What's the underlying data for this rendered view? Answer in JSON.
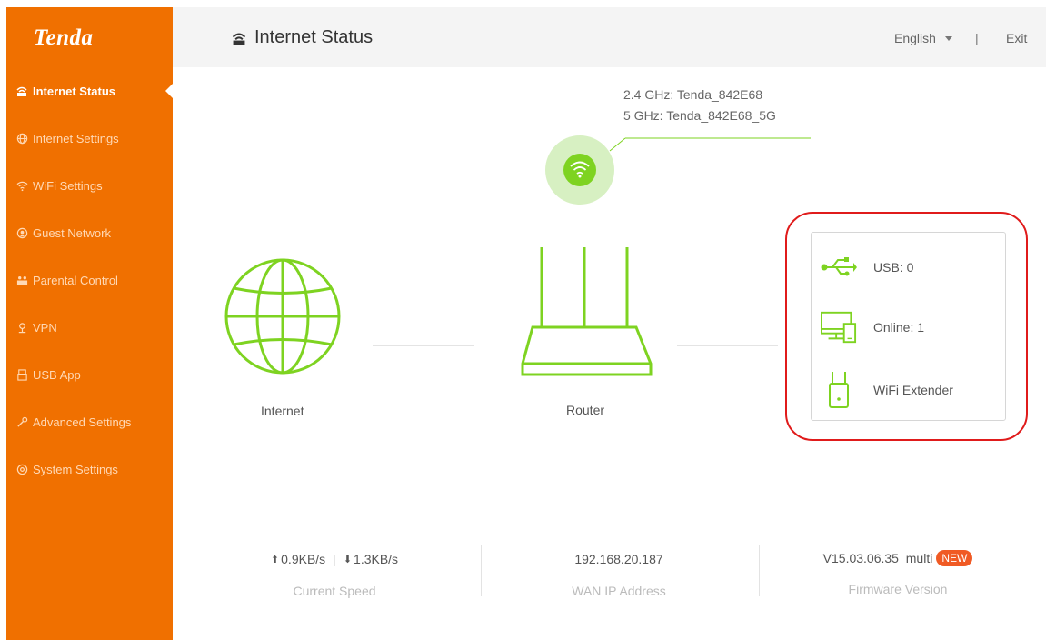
{
  "brand": {
    "logo": "Tenda"
  },
  "sidebar": {
    "items": [
      {
        "label": "Internet Status",
        "icon": "router-status-icon",
        "active": true
      },
      {
        "label": "Internet Settings",
        "icon": "globe-icon",
        "active": false
      },
      {
        "label": "WiFi Settings",
        "icon": "wifi-icon",
        "active": false
      },
      {
        "label": "Guest Network",
        "icon": "guest-icon",
        "active": false
      },
      {
        "label": "Parental Control",
        "icon": "family-icon",
        "active": false
      },
      {
        "label": "VPN",
        "icon": "vpn-icon",
        "active": false
      },
      {
        "label": "USB App",
        "icon": "usb-icon",
        "active": false
      },
      {
        "label": "Advanced Settings",
        "icon": "tools-icon",
        "active": false
      },
      {
        "label": "System Settings",
        "icon": "gear-icon",
        "active": false
      }
    ]
  },
  "header": {
    "title": "Internet Status",
    "language": "English",
    "separator": "|",
    "exit": "Exit"
  },
  "diagram": {
    "ssid_24": "2.4 GHz: Tenda_842E68",
    "ssid_5": "5 GHz: Tenda_842E68_5G",
    "internet_label": "Internet",
    "router_label": "Router",
    "devices": {
      "usb": "USB:  0",
      "online": "Online:  1",
      "extender": "WiFi Extender"
    }
  },
  "stats": {
    "upload": "0.9KB/s",
    "download": "1.3KB/s",
    "speed_label": "Current Speed",
    "wan_ip": "192.168.20.187",
    "wan_label": "WAN IP Address",
    "firmware": "V15.03.06.35_multi",
    "firmware_badge": "NEW",
    "firmware_label": "Firmware Version"
  },
  "colors": {
    "accent": "#f07000",
    "green": "#7ed321",
    "highlight": "#e01b1b",
    "badge": "#f05a24"
  }
}
